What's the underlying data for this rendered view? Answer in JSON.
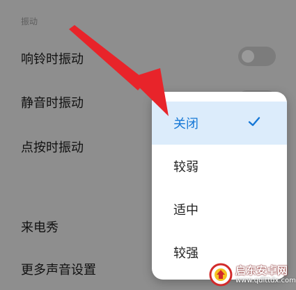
{
  "section_header": "振动",
  "settings": {
    "ring_vibrate": "响铃时振动",
    "silent_vibrate": "静音时振动",
    "touch_vibrate": "点按时振动",
    "incoming_call_show": "来电秀",
    "more_sound_settings": "更多声音设置"
  },
  "toggles": {
    "ring_vibrate": false
  },
  "dropdown": {
    "options": [
      "关闭",
      "较弱",
      "适中",
      "较强"
    ],
    "selected": "关闭",
    "check_icon": "check-icon"
  },
  "annotation": {
    "arrow_color": "#e8242a"
  },
  "watermark": {
    "title": "启东安卓网",
    "url": "www.qdlttdx.com"
  },
  "colors": {
    "selected_text": "#1577d6",
    "selected_bg": "#dcecfb",
    "dim_background": "#8e8e8e"
  }
}
